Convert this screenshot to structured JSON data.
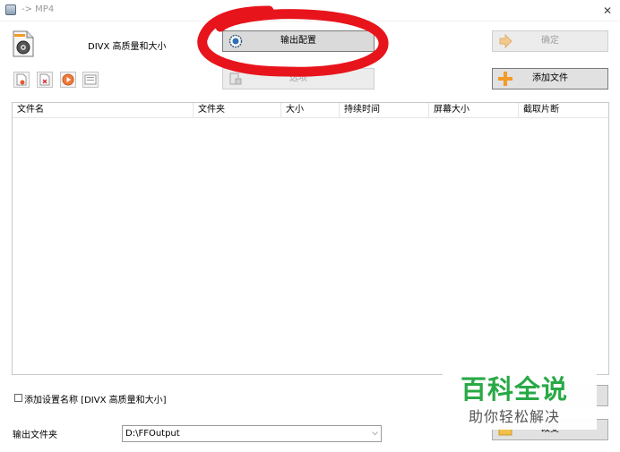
{
  "window": {
    "title": "-> MP4",
    "close_glyph": "✕",
    "close_icon": "close-icon",
    "app_icon": "app-icon"
  },
  "preset": {
    "icon": "video-file-icon",
    "label": "DIVX 高质量和大小"
  },
  "buttons": {
    "output_config": "输出配置",
    "options": "选项",
    "ok": "确定",
    "add_file": "添加文件"
  },
  "toolbar": {
    "icons": [
      "remove-file-icon",
      "clear-list-icon",
      "play-icon",
      "media-info-icon"
    ]
  },
  "file_list": {
    "columns": [
      "文件名",
      "文件夹",
      "大小",
      "持续时间",
      "屏幕大小",
      "截取片断"
    ],
    "rows": []
  },
  "bottom": {
    "add_name_label": "添加设置名称 [DIVX 高质量和大小]",
    "output_folder_label": "输出文件夹",
    "output_folder_value": "D:\\FFOutput",
    "right_button_2_label": "改变"
  },
  "watermark": {
    "main": "百科全说",
    "sub": "助你轻松解决"
  },
  "colors": {
    "annotation_red": "#e8141c",
    "watermark_green": "#29a946",
    "orange_icon": "#f39a28"
  }
}
